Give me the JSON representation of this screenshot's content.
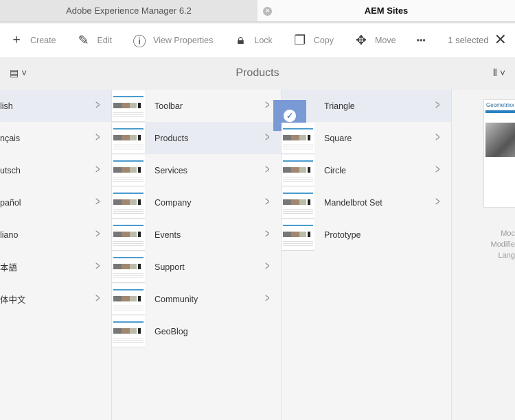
{
  "tabs": [
    {
      "label": "Adobe Experience Manager 6.2"
    },
    {
      "label": "AEM Sites"
    }
  ],
  "toolbar": {
    "create": "Create",
    "edit": "Edit",
    "view_properties": "View Properties",
    "lock": "Lock",
    "copy": "Copy",
    "move": "Move",
    "more": "•••",
    "selected": "1 selected"
  },
  "header": {
    "title": "Products"
  },
  "columns": {
    "languages": [
      {
        "label": "lish"
      },
      {
        "label": "nçais"
      },
      {
        "label": "utsch"
      },
      {
        "label": "pañol"
      },
      {
        "label": "liano"
      },
      {
        "label": "本語"
      },
      {
        "label": "体中文"
      }
    ],
    "pages": [
      {
        "label": "Toolbar"
      },
      {
        "label": "Products"
      },
      {
        "label": "Services"
      },
      {
        "label": "Company"
      },
      {
        "label": "Events"
      },
      {
        "label": "Support"
      },
      {
        "label": "Community"
      },
      {
        "label": "GeoBlog"
      }
    ],
    "products": [
      {
        "label": "Triangle"
      },
      {
        "label": "Square"
      },
      {
        "label": "Circle"
      },
      {
        "label": "Mandelbrot Set"
      },
      {
        "label": "Prototype"
      }
    ]
  },
  "preview": {
    "logo": "Geometrixx",
    "meta": [
      "Moc",
      "Modifie",
      "Lang"
    ]
  },
  "colors": {
    "selection": "#7a9ad6",
    "active_row": "#e8ebf2"
  }
}
